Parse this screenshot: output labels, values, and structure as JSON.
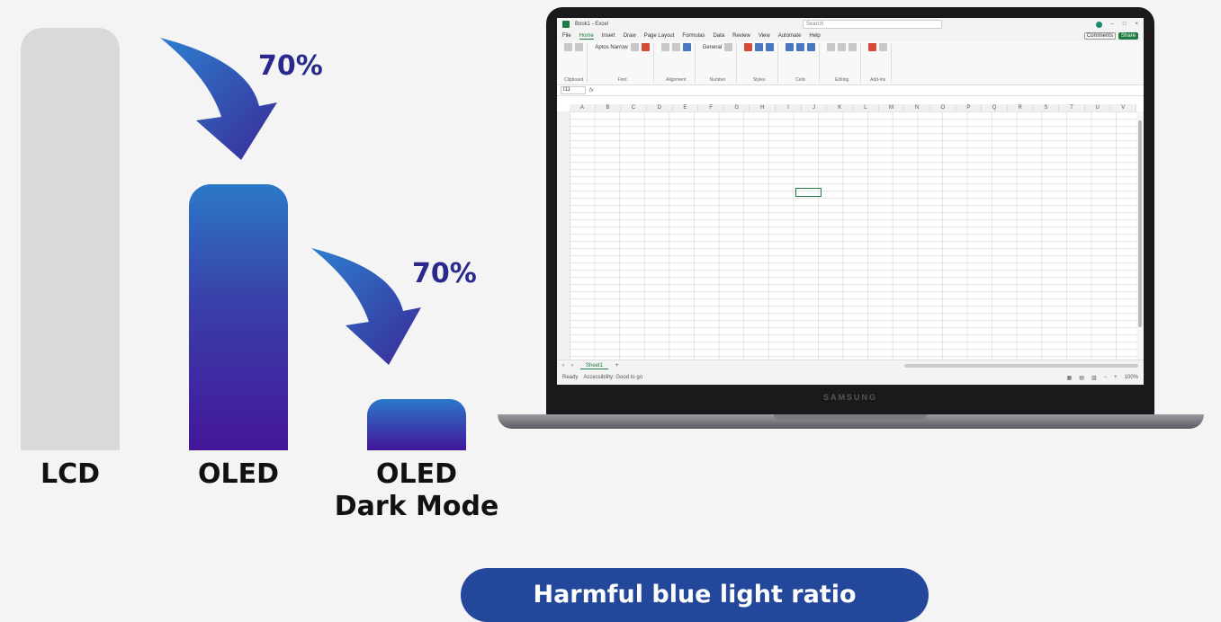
{
  "chart": {
    "bars": [
      {
        "label": "LCD",
        "level": 1.0
      },
      {
        "label": "OLED",
        "level": 0.63
      },
      {
        "label_line1": "OLED",
        "label_line2": "Dark Mode",
        "level": 0.12
      }
    ],
    "reductions": [
      "70%",
      "70%"
    ],
    "caption": "Harmful blue light ratio"
  },
  "laptop": {
    "brand": "SAMSUNG",
    "excel": {
      "title": "Book1 - Excel",
      "search_placeholder": "Search",
      "menu": [
        "File",
        "Home",
        "Insert",
        "Draw",
        "Page Layout",
        "Formulas",
        "Data",
        "Review",
        "View",
        "Automate",
        "Help"
      ],
      "comments_label": "Comments",
      "share_label": "Share",
      "ribbon_groups": [
        "Clipboard",
        "Font",
        "Alignment",
        "Number",
        "Styles",
        "Cells",
        "Editing",
        "Add-ins"
      ],
      "font_name": "Aptos Narrow",
      "number_format": "General",
      "namebox": "I11",
      "fx": "fx",
      "columns": [
        "A",
        "B",
        "C",
        "D",
        "E",
        "F",
        "G",
        "H",
        "I",
        "J",
        "K",
        "L",
        "M",
        "N",
        "O",
        "P",
        "Q",
        "R",
        "S",
        "T",
        "U",
        "V"
      ],
      "sheet_tab": "Sheet1",
      "status_left": "Ready",
      "status_accessibility": "Accessibility: Good to go",
      "zoom": "100%"
    }
  }
}
